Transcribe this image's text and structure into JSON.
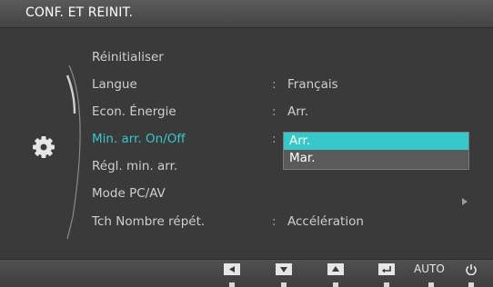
{
  "header": {
    "title": "CONF. ET REINIT."
  },
  "menu": {
    "items": [
      {
        "label": "Réinitialiser"
      },
      {
        "label": "Langue",
        "value": "Français"
      },
      {
        "label": "Econ. Énergie",
        "value": "Arr."
      },
      {
        "label": "Min. arr. On/Off",
        "active": true
      },
      {
        "label": "Régl. min. arr."
      },
      {
        "label": "Mode PC/AV",
        "submenu": true
      },
      {
        "label": "Tch Nombre répét.",
        "value": "Accélération"
      }
    ],
    "colon": ":"
  },
  "dropdown": {
    "options": [
      "Arr.",
      "Mar."
    ],
    "selected": "Arr."
  },
  "buttons": {
    "auto_label": "AUTO",
    "icons": [
      "left-arrow-icon",
      "down-arrow-icon",
      "up-arrow-icon",
      "enter-icon",
      "auto-button",
      "power-icon"
    ]
  },
  "colors": {
    "background": "#3a3a3a",
    "highlight": "#36c8c8",
    "text": "#cfcfcf"
  }
}
